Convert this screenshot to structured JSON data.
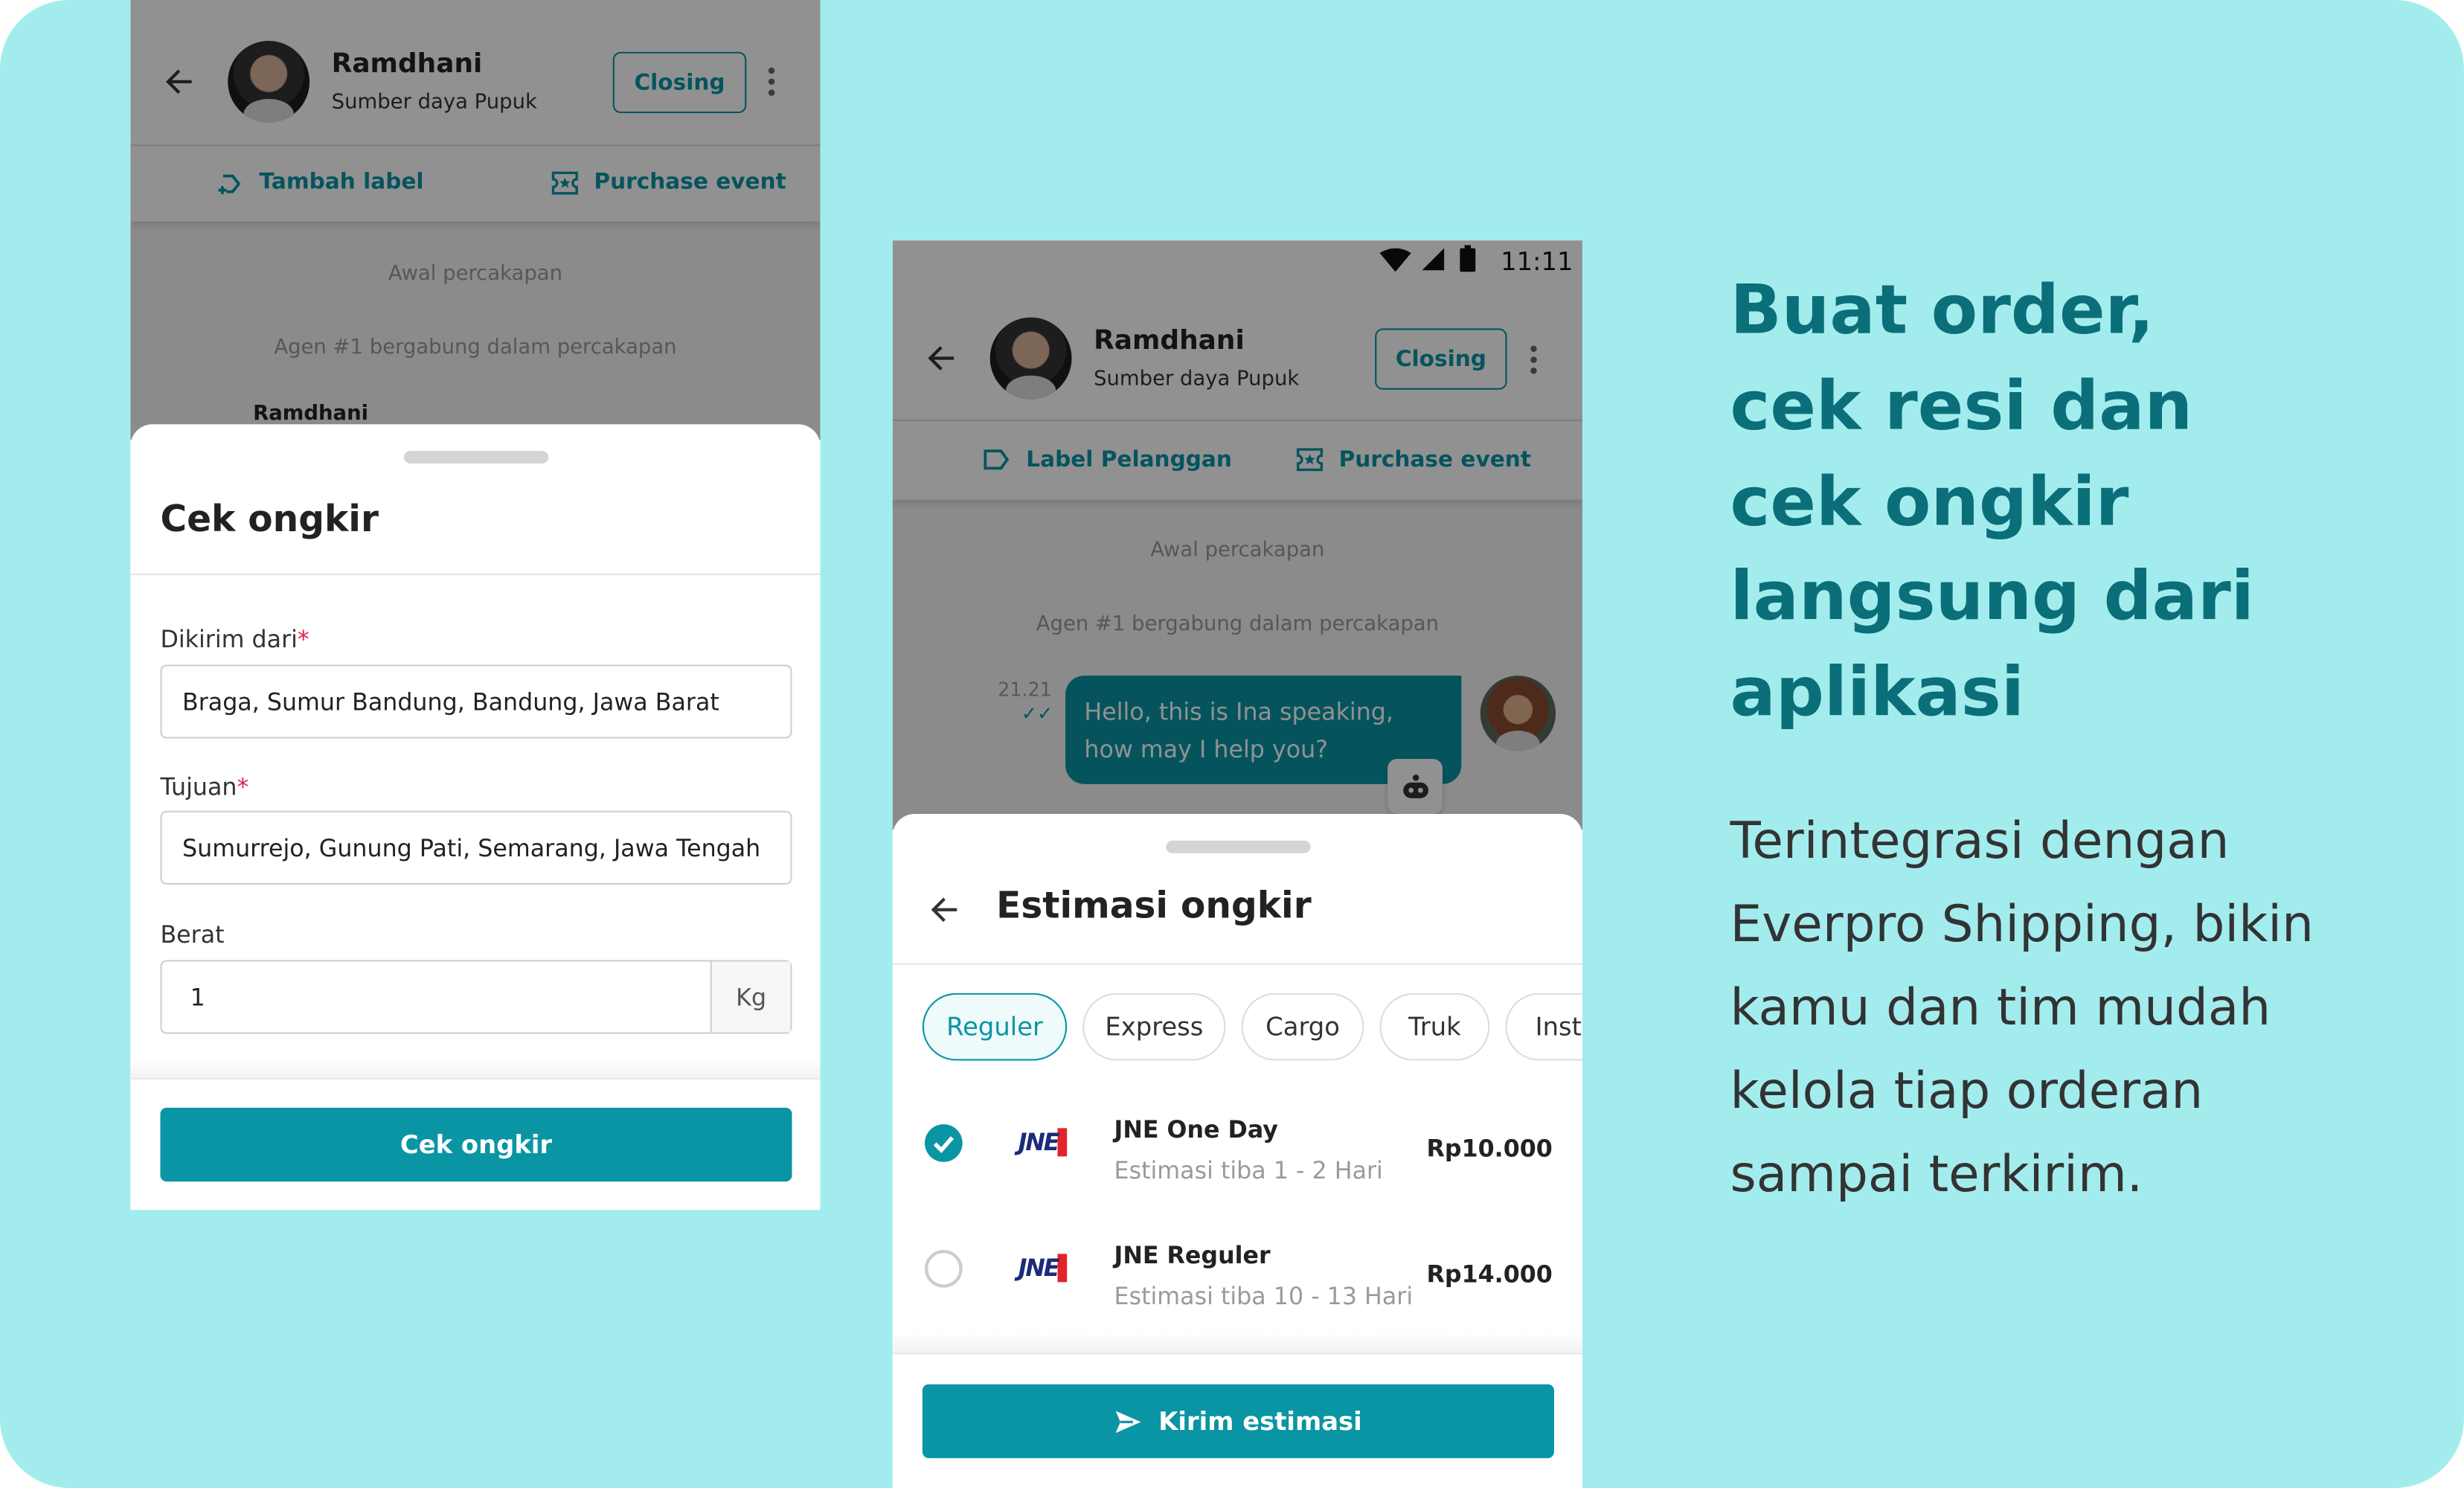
{
  "left_phone": {
    "header": {
      "name": "Ramdhani",
      "subtitle": "Sumber daya Pupuk",
      "closing_label": "Closing"
    },
    "actions": {
      "label": "Tambah label",
      "purchase": "Purchase event"
    },
    "chat": {
      "start": "Awal percakapan",
      "joined": "Agen #1 bergabung dalam percakapan",
      "sender": "Ramdhani"
    },
    "sheet": {
      "title": "Cek ongkir",
      "from_label": "Dikirim dari",
      "from_value": "Braga, Sumur Bandung, Bandung, Jawa Barat",
      "to_label": "Tujuan",
      "to_value": "Sumurrejo, Gunung Pati, Semarang, Jawa Tengah",
      "weight_label": "Berat",
      "weight_value": "1",
      "weight_unit": "Kg",
      "required_mark": "*",
      "submit_label": "Cek ongkir"
    }
  },
  "right_phone": {
    "status_bar": {
      "time": "11:11"
    },
    "header": {
      "name": "Ramdhani",
      "subtitle": "Sumber daya Pupuk",
      "closing_label": "Closing"
    },
    "actions": {
      "label": "Label Pelanggan",
      "purchase": "Purchase event"
    },
    "chat": {
      "start": "Awal percakapan",
      "joined": "Agen #1 bergabung dalam percakapan",
      "time": "21.21",
      "message": "Hello, this is Ina speaking, how may I help you?"
    },
    "sheet": {
      "title": "Estimasi ongkir",
      "chips": [
        {
          "label": "Reguler",
          "active": true
        },
        {
          "label": "Express"
        },
        {
          "label": "Cargo"
        },
        {
          "label": "Truk"
        },
        {
          "label": "Insta"
        }
      ],
      "options": [
        {
          "logo": "JNE",
          "name": "JNE One Day",
          "eta": "Estimasi tiba 1 - 2 Hari",
          "price": "Rp10.000",
          "selected": true
        },
        {
          "logo": "JNE",
          "name": "JNE Reguler",
          "eta": "Estimasi tiba 10 - 13 Hari",
          "price": "Rp14.000",
          "selected": false
        }
      ],
      "submit_label": "Kirim estimasi"
    }
  },
  "promo": {
    "headline": [
      "Buat order,",
      "cek resi dan",
      "cek ongkir",
      "langsung dari",
      "aplikasi"
    ],
    "body": [
      "Terintegrasi dengan",
      "Everpro Shipping, bikin",
      "kamu dan tim mudah",
      "kelola tiap orderan",
      "sampai terkirim."
    ]
  },
  "colors": {
    "background": "#a3ecee",
    "accent": "#0a95a4",
    "headline": "#0b6f79",
    "required": "#e0224a"
  }
}
